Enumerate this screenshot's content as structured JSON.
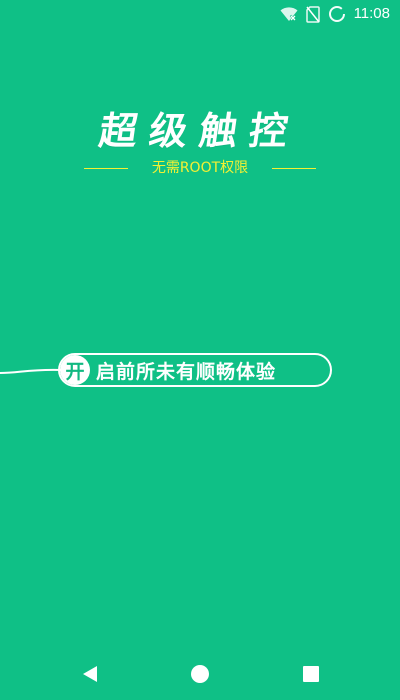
{
  "status_bar": {
    "time": "11:08",
    "icons": [
      "wifi-no-internet-icon",
      "no-sim-icon",
      "battery-charging-icon"
    ]
  },
  "title": "超级触控",
  "subtitle": "无需ROOT权限",
  "start_button": {
    "circle_char": "开",
    "label": "启前所未有顺畅体验"
  },
  "nav_bar": {
    "icons": [
      "back-icon",
      "home-icon",
      "recent-apps-icon"
    ]
  },
  "colors": {
    "background": "#0fc086",
    "accent_yellow": "#f4f133",
    "white": "#ffffff"
  }
}
